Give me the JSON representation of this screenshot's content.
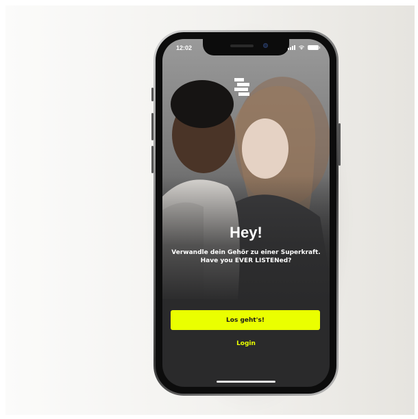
{
  "status_bar": {
    "time": "12:02"
  },
  "icons": {
    "logo": "brand-logo-icon",
    "signal": "signal-icon",
    "wifi": "wifi-icon",
    "battery": "battery-icon"
  },
  "onboarding": {
    "headline": "Hey!",
    "tagline_line1": "Verwandle dein Gehör zu einer Superkraft.",
    "tagline_line2": "Have you EVER LISTENed?",
    "primary_button": "Los geht's!",
    "secondary_link": "Login"
  },
  "colors": {
    "accent": "#eaff00",
    "screen_background": "#2a2a2b",
    "text": "#ffffff"
  }
}
